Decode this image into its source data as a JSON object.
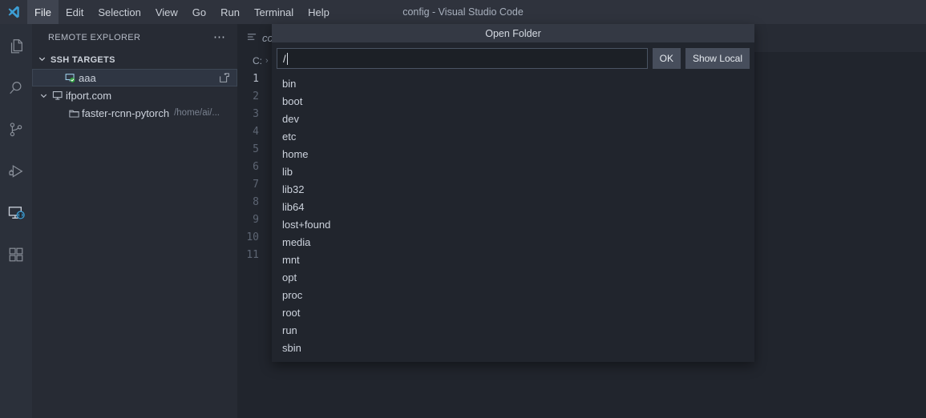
{
  "window": {
    "title": "config - Visual Studio Code",
    "logo_icon": "vscode-logo-icon"
  },
  "menubar": {
    "items": [
      {
        "label": "File",
        "active": true
      },
      {
        "label": "Edit",
        "active": false
      },
      {
        "label": "Selection",
        "active": false
      },
      {
        "label": "View",
        "active": false
      },
      {
        "label": "Go",
        "active": false
      },
      {
        "label": "Run",
        "active": false
      },
      {
        "label": "Terminal",
        "active": false
      },
      {
        "label": "Help",
        "active": false
      }
    ]
  },
  "activitybar": {
    "items": [
      {
        "icon": "files-explorer-icon",
        "active": false
      },
      {
        "icon": "search-icon",
        "active": false
      },
      {
        "icon": "source-control-icon",
        "active": false
      },
      {
        "icon": "run-and-debug-icon",
        "active": false
      },
      {
        "icon": "remote-explorer-icon",
        "active": true
      },
      {
        "icon": "extensions-icon",
        "active": false
      }
    ]
  },
  "sidebar": {
    "title": "REMOTE EXPLORER",
    "more_actions_icon": "ellipsis-icon",
    "section": {
      "label": "SSH TARGETS",
      "expanded": true,
      "chevron_icon": "chevron-down-icon"
    },
    "tree": [
      {
        "label": "aaa",
        "description": "",
        "icon": "remote-host-connected-icon",
        "selected": true,
        "expanded": null,
        "indent": 1,
        "action_icon": "open-in-new-window-icon"
      },
      {
        "label": "ifport.com",
        "description": "",
        "icon": "remote-host-icon",
        "selected": false,
        "expanded": true,
        "indent": 0,
        "action_icon": ""
      },
      {
        "label": "faster-rcnn-pytorch",
        "description": "/home/ai/...",
        "icon": "folder-icon",
        "selected": false,
        "expanded": null,
        "indent": 2,
        "action_icon": ""
      }
    ]
  },
  "editor": {
    "tab": {
      "label": "co",
      "icon": "settings-file-icon",
      "preview": true
    },
    "breadcrumb": {
      "root": "C:",
      "separator": "›",
      "trailing": ""
    },
    "line_numbers": [
      "1",
      "2",
      "3",
      "4",
      "5",
      "6",
      "7",
      "8",
      "9",
      "10",
      "11"
    ],
    "current_line": "1"
  },
  "dialog": {
    "title": "Open Folder",
    "input": {
      "value": "/",
      "placeholder": ""
    },
    "buttons": [
      {
        "label": "OK",
        "name": "ok-button"
      },
      {
        "label": "Show Local",
        "name": "show-local-button"
      }
    ],
    "items": [
      "bin",
      "boot",
      "dev",
      "etc",
      "home",
      "lib",
      "lib32",
      "lib64",
      "lost+found",
      "media",
      "mnt",
      "opt",
      "proc",
      "root",
      "run",
      "sbin"
    ]
  },
  "colors": {
    "titlebar_bg": "#2f333d",
    "activitybar_bg": "#2b303a",
    "sidebar_bg": "#272b34",
    "editor_bg": "#21252d",
    "dialog_title_bg": "#343944",
    "accent_blue": "#4d9fd8",
    "status_green": "#3aa33a",
    "button_bg": "#474e5c",
    "selected_row_bg": "#2f3643"
  }
}
